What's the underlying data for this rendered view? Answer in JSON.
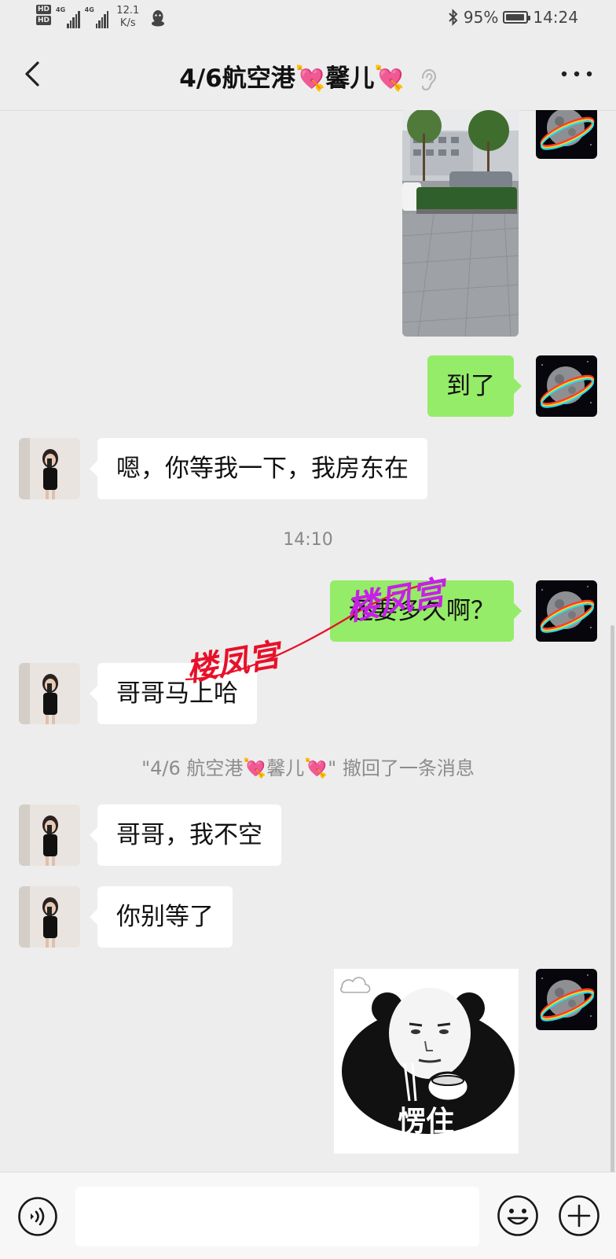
{
  "status_bar": {
    "sim1": "HD",
    "sim2": "HD",
    "net1": "4G",
    "net2": "4G",
    "speed_value": "12.1",
    "speed_unit": "K/s",
    "battery": "95%",
    "battery_level": 0.95,
    "time": "14:24"
  },
  "header": {
    "title": "4/6航空港💘馨儿💘"
  },
  "chat": {
    "msg_arrived": "到了",
    "msg_wait": "嗯，你等我一下，我房东在",
    "time_1": "14:10",
    "msg_how_long": "还要多久啊？",
    "msg_soon": "哥哥马上哈",
    "recall_notice": "\"4/6 航空港💘馨儿💘\" 撤回了一条消息",
    "msg_busy": "哥哥，我不空",
    "msg_dont_wait": "你别等了",
    "sticker_caption": "愣住"
  },
  "watermarks": {
    "wm1": "楼凤宫",
    "wm2": "楼凤宫",
    "wm1_color": "#e8102a",
    "wm2_color": "#c81fe8"
  },
  "input": {
    "placeholder": ""
  },
  "colors": {
    "self_bubble": "#95ec69",
    "other_bubble": "#ffffff",
    "background": "#ededed"
  },
  "icons": [
    "back-arrow-icon",
    "ear-icon",
    "more-icon",
    "voice-icon",
    "emoji-icon",
    "plus-icon",
    "bluetooth-icon",
    "qq-icon"
  ]
}
